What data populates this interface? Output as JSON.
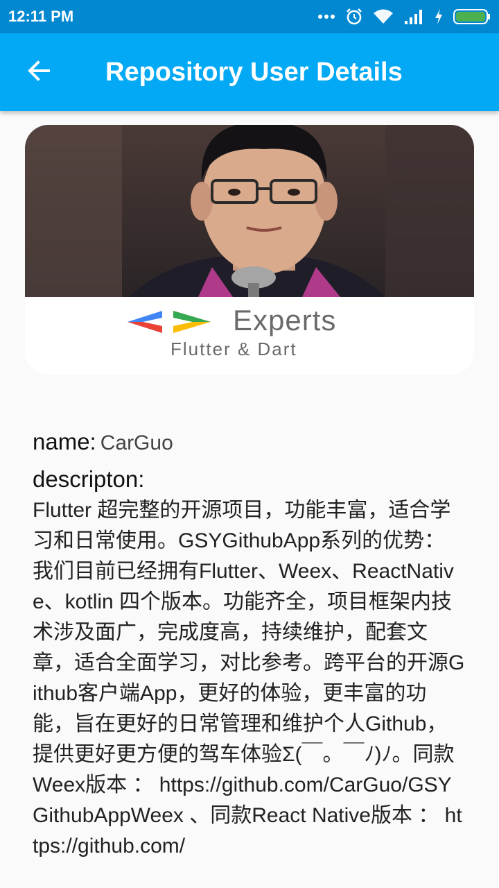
{
  "status_bar": {
    "time": "12:11 PM",
    "icons": [
      "more-dots-icon",
      "alarm-icon",
      "wifi-icon",
      "signal-icon",
      "charging-icon",
      "battery-icon"
    ],
    "battery_color": "#4caf50"
  },
  "app_bar": {
    "title": "Repository User Details",
    "back_icon": "arrow-back-icon",
    "color": "#03a9f4"
  },
  "avatar": {
    "logo_text": "Experts",
    "logo_subtext": "Flutter & Dart"
  },
  "details": {
    "name_label": "name:",
    "name_value": "CarGuo",
    "description_label": "descripton:",
    "description_value": "Flutter 超完整的开源项目，功能丰富，适合学习和日常使用。GSYGithubApp系列的优势：我们目前已经拥有Flutter、Weex、ReactNative、kotlin 四个版本。功能齐全，项目框架内技术涉及面广，完成度高，持续维护，配套文章，适合全面学习，对比参考。跨平台的开源Github客户端App，更好的体验，更丰富的功能，旨在更好的日常管理和维护个人Github，提供更好更方便的驾车体验Σ(￣。￣ﾉ)ﾉ。同款Weex版本 ： https://github.com/CarGuo/GSYGithubAppWeex 、同款React Native版本 ： https://github.com/"
  }
}
